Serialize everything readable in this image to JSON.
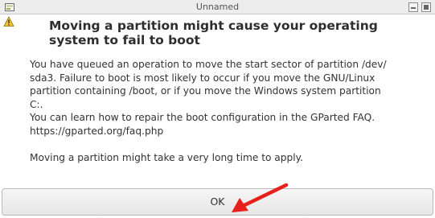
{
  "window": {
    "title": "Unnamed"
  },
  "dialog": {
    "heading": "Moving a partition might cause your operating system to fail to boot",
    "paragraphs": {
      "p1_line1": "You have queued an operation to move the start sector of partition /dev/",
      "p1_line2": "sda3.  Failure to boot is most likely to occur if you move the GNU/Linux",
      "p1_line3": "partition containing /boot, or if you move the Windows system partition",
      "p1_line4": "C:.",
      "p2_line1": "You can learn how to repair the boot configuration in the GParted FAQ.",
      "p2_line2": "https://gparted.org/faq.php",
      "p3_line1": "Moving a partition might take a very long time to apply."
    },
    "ok_label": "OK"
  },
  "annotation": {
    "arrow_color": "#e8201c"
  },
  "icons": {
    "app": "gparted-app-icon",
    "warning": "warning-icon"
  }
}
